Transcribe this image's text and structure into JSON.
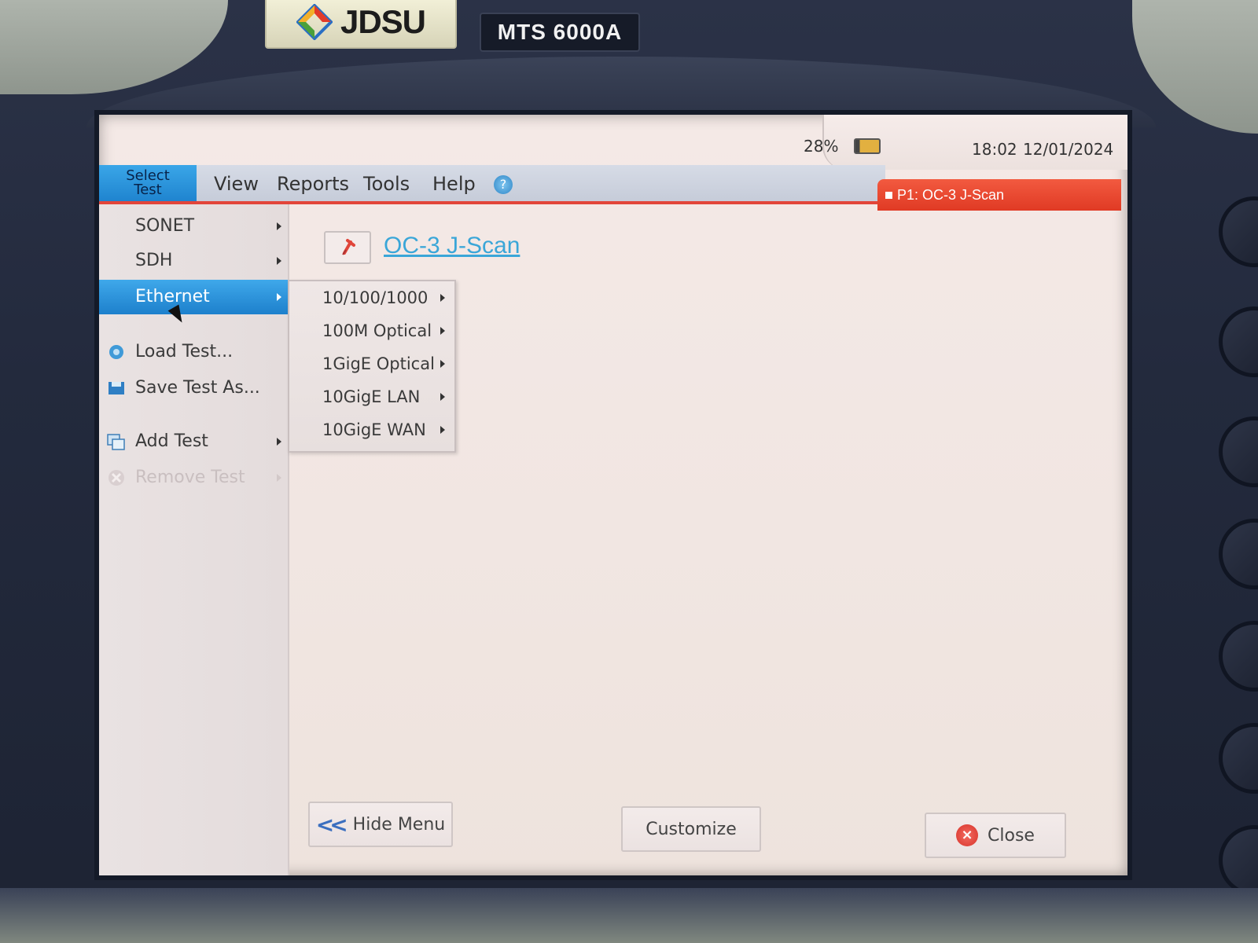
{
  "device": {
    "brand": "JDSU",
    "model": "MTS 6000A"
  },
  "status": {
    "battery_percent": "28%",
    "time": "18:02",
    "date": "12/01/2024"
  },
  "menubar": {
    "select_test_line1": "Select",
    "select_test_line2": "Test",
    "items": [
      "View",
      "Reports",
      "Tools",
      "Help"
    ],
    "help_icon_glyph": "?"
  },
  "active_test_tab": {
    "label": "P1: OC-3 J-Scan"
  },
  "select_panel": {
    "items": [
      {
        "label": "SONET",
        "has_submenu": true
      },
      {
        "label": "SDH",
        "has_submenu": true
      },
      {
        "label": "Ethernet",
        "has_submenu": true,
        "active": true
      },
      {
        "label": "Load Test...",
        "icon": "gear-icon"
      },
      {
        "label": "Save Test As...",
        "icon": "save-icon"
      },
      {
        "label": "Add Test",
        "icon": "add-test-icon",
        "has_submenu": true
      },
      {
        "label": "Remove Test",
        "icon": "remove-icon",
        "has_submenu": true,
        "disabled": true
      }
    ]
  },
  "ethernet_submenu": {
    "items": [
      "10/100/1000",
      "100M Optical",
      "1GigE Optical",
      "10GigE LAN",
      "10GigE WAN"
    ]
  },
  "main": {
    "current_test": "OC-3 J-Scan"
  },
  "buttons": {
    "hide_menu": "Hide Menu",
    "customize": "Customize",
    "close": "Close"
  },
  "colors": {
    "accent_blue": "#1f84cf",
    "alert_red": "#e03a24",
    "link_blue": "#3aa6d8"
  }
}
